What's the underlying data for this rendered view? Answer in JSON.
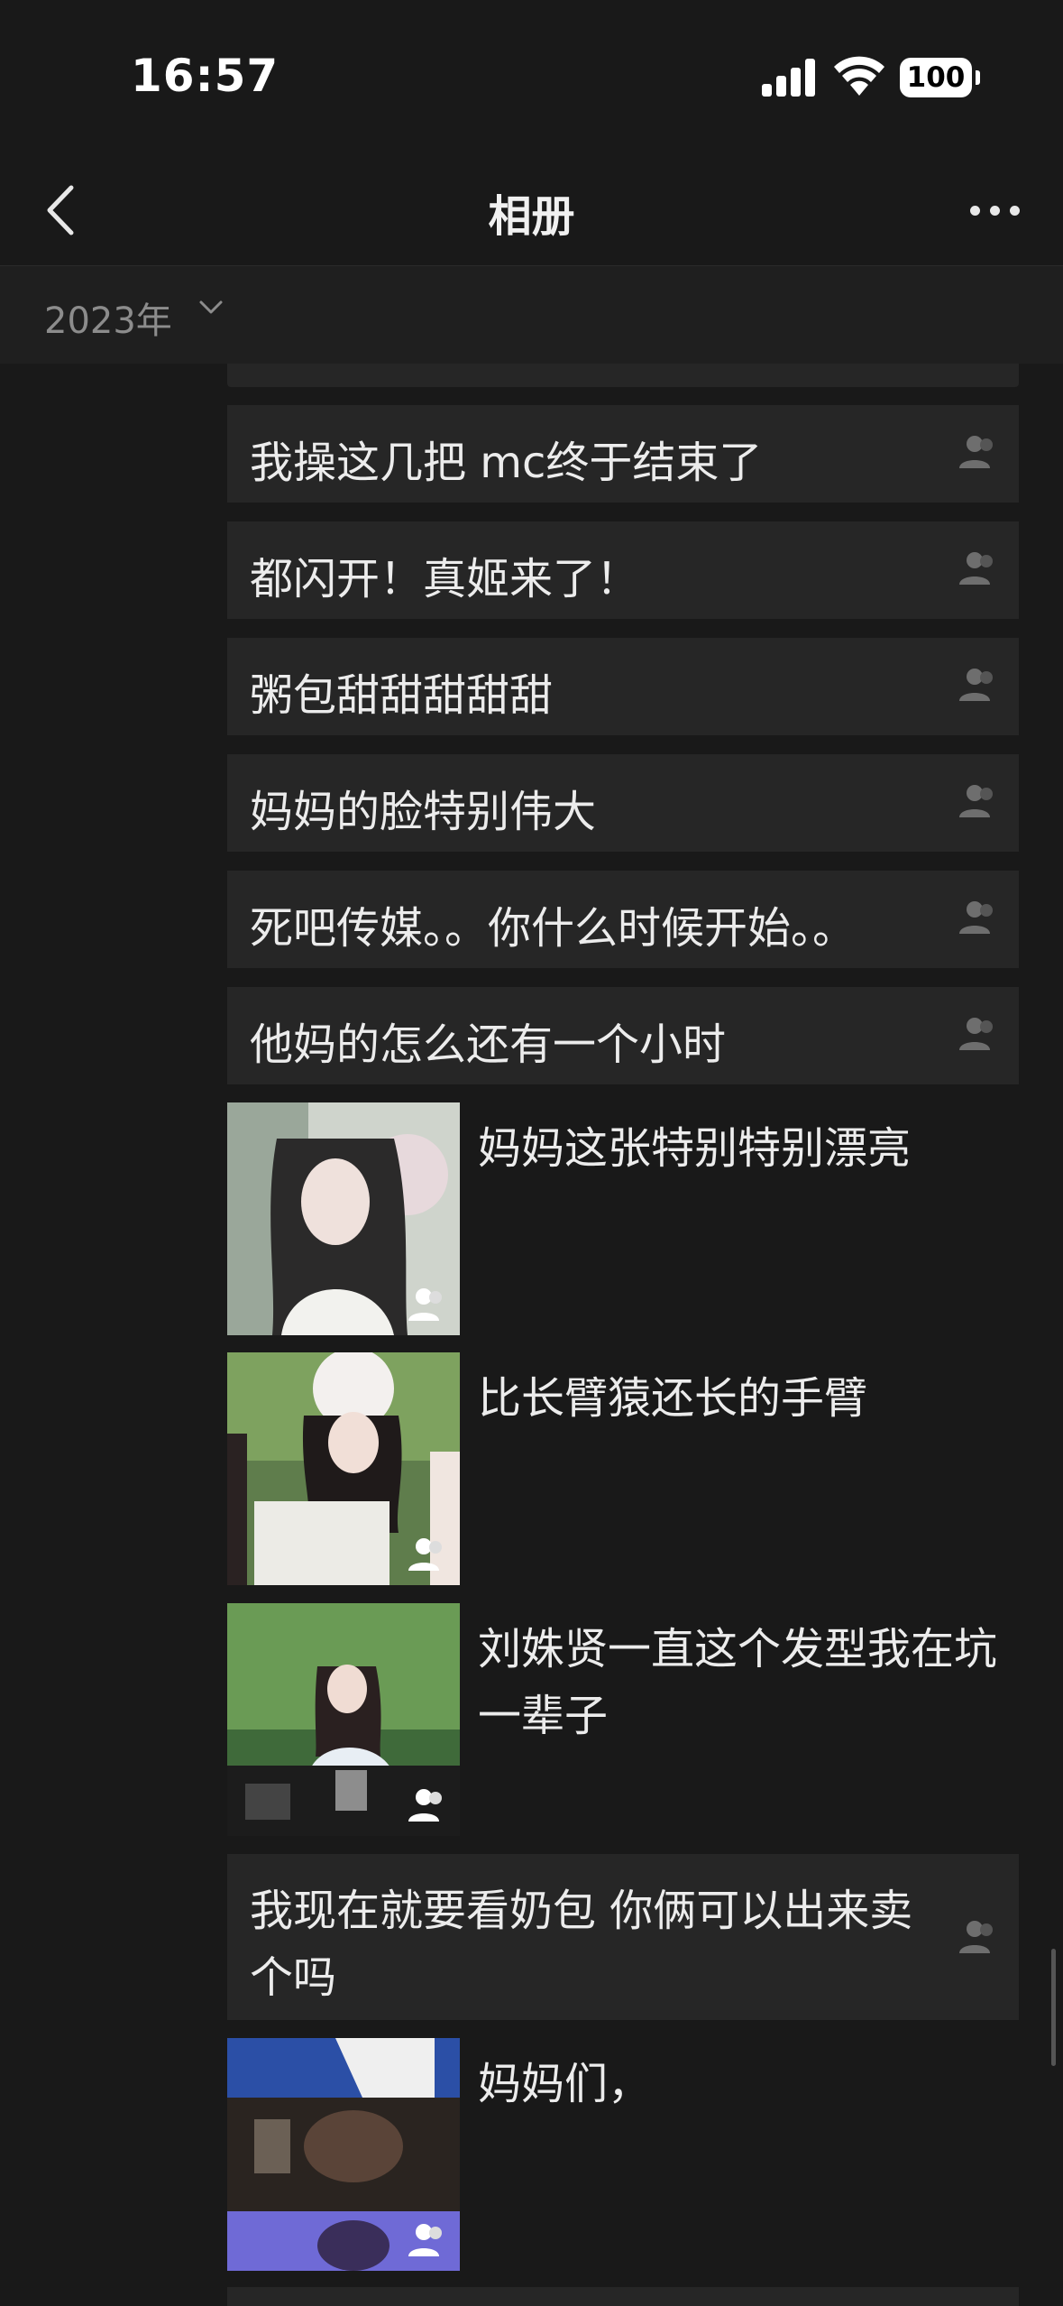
{
  "status_bar": {
    "time": "16:57",
    "battery": "100"
  },
  "nav": {
    "title": "相册"
  },
  "year_filter": {
    "label": "2023年"
  },
  "posts": [
    {
      "text": "我操这几把 mc终于结束了"
    },
    {
      "text": "都闪开！真姬来了！"
    },
    {
      "text": "粥包甜甜甜甜甜"
    },
    {
      "text": "妈妈的脸特别伟大"
    },
    {
      "text": "死吧传媒。。你什么时候开始。。"
    },
    {
      "text": "他妈的怎么还有一个小时"
    },
    {
      "text": "妈妈这张特别特别漂亮"
    },
    {
      "text": "比长臂猿还长的手臂"
    },
    {
      "text": "刘姝贤一直这个发型我在坑一辈子"
    },
    {
      "text": "我现在就要看奶包 你俩可以出来卖个吗"
    },
    {
      "text": "妈妈们，"
    }
  ],
  "icons": {
    "back": "chevron-left-icon",
    "more": "more-dots-icon",
    "year_dropdown": "chevron-down-icon",
    "visibility": "friends-only-person-icon"
  },
  "colors": {
    "background": "#191919",
    "card": "#262626",
    "text": "#ececec",
    "muted": "#8c8c8c"
  }
}
